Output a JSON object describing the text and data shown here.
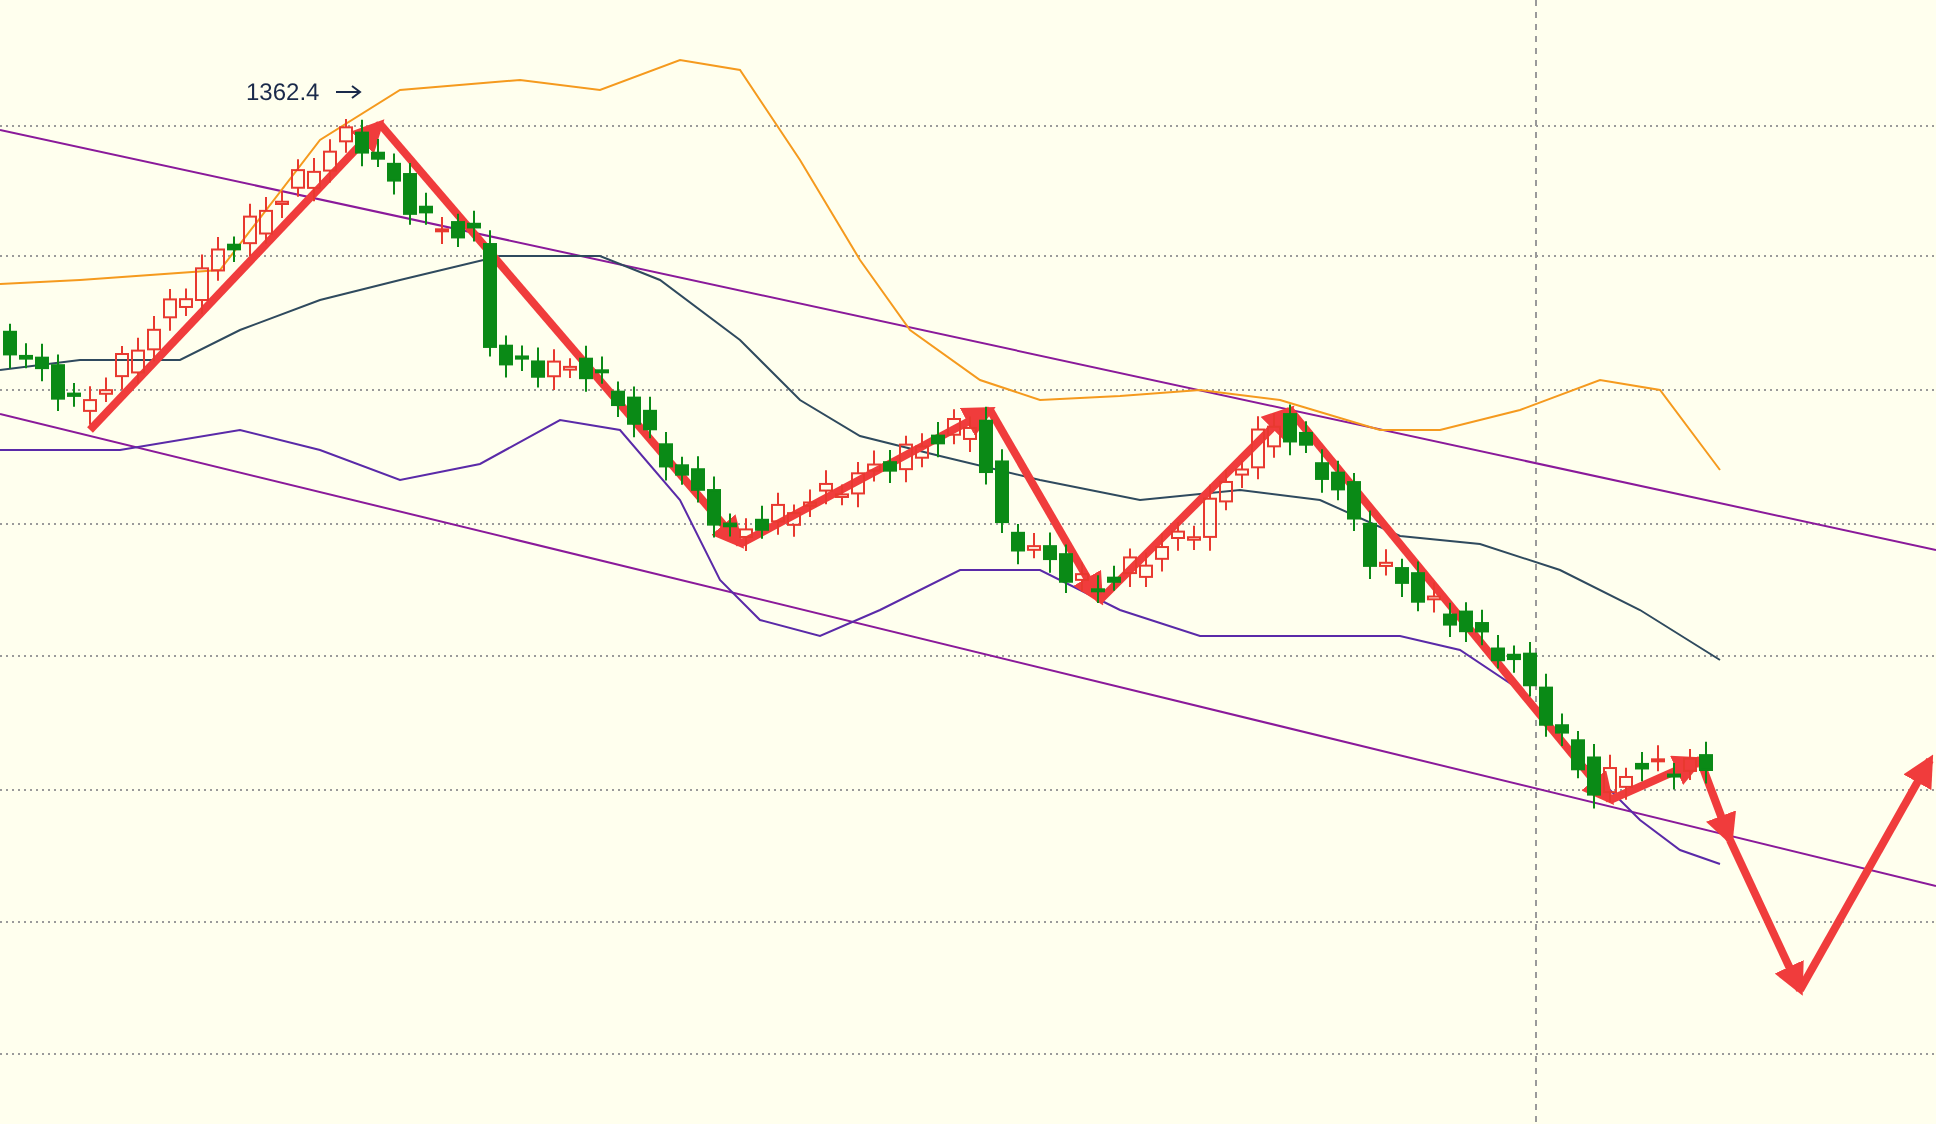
{
  "chart": {
    "high_label": "1362.4"
  }
}
